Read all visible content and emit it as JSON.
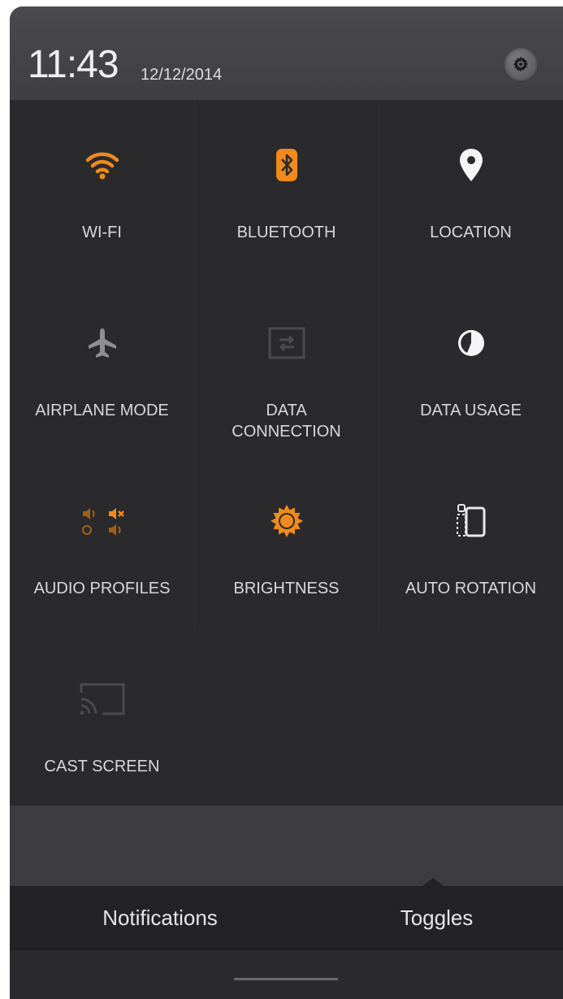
{
  "header": {
    "time": "11:43",
    "date": "12/12/2014",
    "settings_icon": "gear-icon"
  },
  "toggles": [
    {
      "label": "WI-FI",
      "icon": "wifi-icon",
      "active": true
    },
    {
      "label": "BLUETOOTH",
      "icon": "bluetooth-icon",
      "active": true
    },
    {
      "label": "LOCATION",
      "icon": "location-pin-icon",
      "active": true
    },
    {
      "label": "AIRPLANE MODE",
      "icon": "airplane-icon",
      "active": false
    },
    {
      "label": "DATA\nCONNECTION",
      "icon": "data-connection-icon",
      "active": false
    },
    {
      "label": "DATA USAGE",
      "icon": "data-usage-icon",
      "active": true
    },
    {
      "label": "AUDIO PROFILES",
      "icon": "audio-profiles-icon",
      "active": true
    },
    {
      "label": "BRIGHTNESS",
      "icon": "brightness-icon",
      "active": true
    },
    {
      "label": "AUTO ROTATION",
      "icon": "auto-rotation-icon",
      "active": true
    },
    {
      "label": "CAST SCREEN",
      "icon": "cast-screen-icon",
      "active": false
    }
  ],
  "tabs": {
    "notifications": "Notifications",
    "toggles": "Toggles",
    "selected": "toggles"
  },
  "colors": {
    "accent": "#f08a1c",
    "active_white": "#f5f5f5",
    "inactive": "#6b6b6e",
    "background": "#2a2a2d"
  }
}
